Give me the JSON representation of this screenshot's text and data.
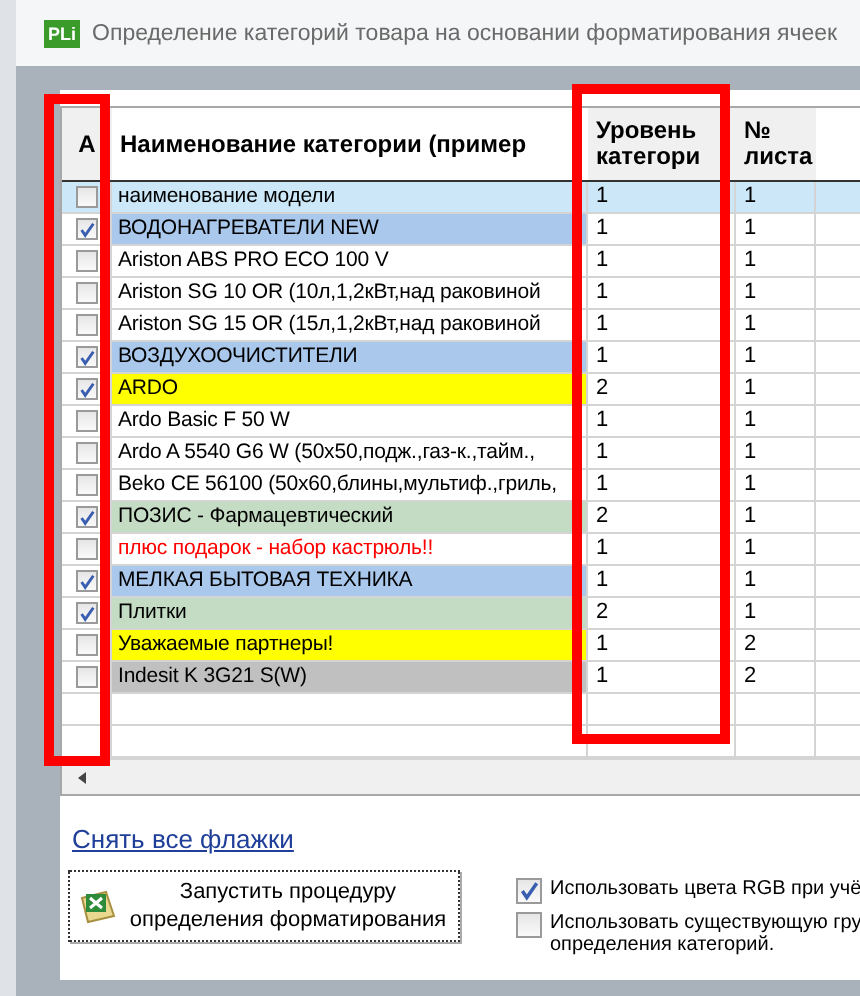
{
  "window": {
    "icon_label": "PLi",
    "title": "Определение категорий товара на основании форматирования ячеек"
  },
  "table": {
    "columns": [
      "A",
      "Наименование категории (пример",
      "Уровень категори",
      "№ листа"
    ],
    "rows": [
      {
        "checked": false,
        "selected": true,
        "kind": "item",
        "name": "наименование модели",
        "color": "#cce8f8",
        "level": "1",
        "sheet": "1"
      },
      {
        "checked": true,
        "selected": false,
        "kind": "item",
        "name": "ВОДОНАГРЕВАТЕЛИ   NEW",
        "color": "#a9c8ec",
        "level": "1",
        "sheet": "1"
      },
      {
        "checked": false,
        "selected": false,
        "kind": "item",
        "name": "Ariston ABS PRO ECO 100 V",
        "color": "#ffffff",
        "level": "1",
        "sheet": "1"
      },
      {
        "checked": false,
        "selected": false,
        "kind": "item",
        "name": "Ariston SG 10 OR (10л,1,2кВт,над раковиной",
        "color": "#ffffff",
        "level": "1",
        "sheet": "1"
      },
      {
        "checked": false,
        "selected": false,
        "kind": "item",
        "name": "Ariston SG 15 OR (15л,1,2кВт,над раковиной",
        "color": "#ffffff",
        "level": "1",
        "sheet": "1"
      },
      {
        "checked": true,
        "selected": false,
        "kind": "item",
        "name": "ВОЗДУХООЧИСТИТЕЛИ",
        "color": "#a9c8ec",
        "level": "1",
        "sheet": "1"
      },
      {
        "checked": true,
        "selected": false,
        "kind": "item",
        "name": "ARDO",
        "color": "#ffff00",
        "level": "2",
        "sheet": "1"
      },
      {
        "checked": false,
        "selected": false,
        "kind": "item",
        "name": "Ardo Basic F 50 W",
        "color": "#ffffff",
        "level": "1",
        "sheet": "1"
      },
      {
        "checked": false,
        "selected": false,
        "kind": "item",
        "name": "Ardo A 5540 G6 W (50x50,подж.,газ-к.,тайм.,",
        "color": "#ffffff",
        "level": "1",
        "sheet": "1"
      },
      {
        "checked": false,
        "selected": false,
        "kind": "item",
        "name": "Beko CE 56100 (50x60,блины,мультиф.,гриль,",
        "color": "#ffffff",
        "level": "1",
        "sheet": "1"
      },
      {
        "checked": true,
        "selected": false,
        "kind": "item",
        "name": "ПОЗИС - Фармацевтический",
        "color": "#c4dcc4",
        "level": "2",
        "sheet": "1"
      },
      {
        "checked": false,
        "selected": false,
        "kind": "note",
        "name": "плюс подарок - набор кастрюль!!",
        "color": "#ffffff",
        "level": "1",
        "sheet": "1"
      },
      {
        "checked": true,
        "selected": false,
        "kind": "item",
        "name": "МЕЛКАЯ БЫТОВАЯ ТЕХНИКА",
        "color": "#a9c8ec",
        "level": "1",
        "sheet": "1"
      },
      {
        "checked": true,
        "selected": false,
        "kind": "item",
        "name": "Плитки",
        "color": "#c4dcc4",
        "level": "2",
        "sheet": "1"
      },
      {
        "checked": false,
        "selected": false,
        "kind": "item",
        "name": "Уважаемые партнеры!",
        "color": "#ffff00",
        "level": "1",
        "sheet": "2"
      },
      {
        "checked": false,
        "selected": false,
        "kind": "item",
        "name": "Indesit K 3G21 S(W)",
        "color": "#c0c0c0",
        "level": "1",
        "sheet": "2"
      }
    ]
  },
  "clear_link": "Снять все флажки",
  "run_button": {
    "line_1": "Запустить процедуру",
    "line_2": "определения форматирования"
  },
  "options": [
    {
      "checked": true,
      "label": "Использовать цвета RGB при учё"
    },
    {
      "checked": false,
      "label": "Использовать существующую гру определения категорий."
    }
  ]
}
